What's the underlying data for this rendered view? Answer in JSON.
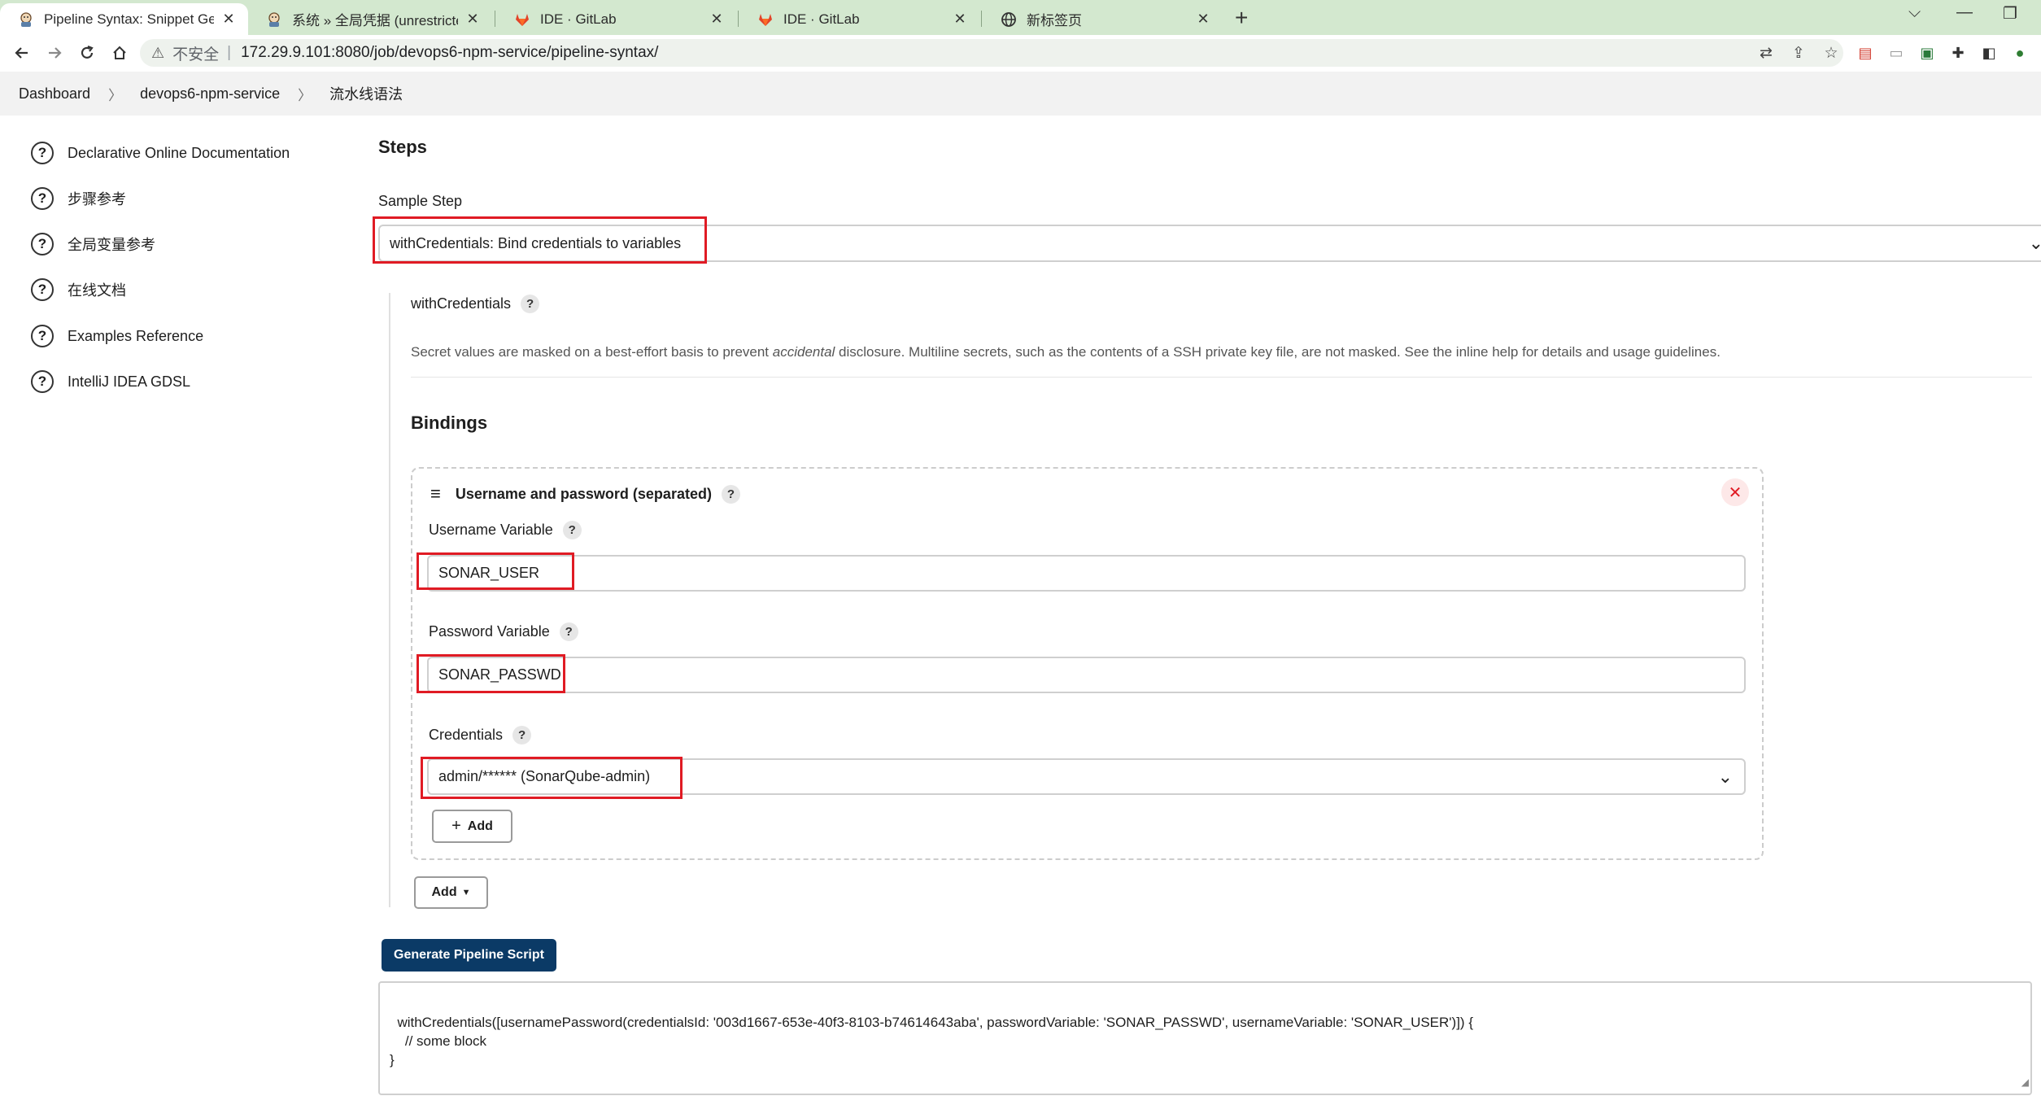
{
  "browser": {
    "tabs": [
      {
        "label": "Pipeline Syntax: Snippet Gene",
        "active": true,
        "icon": "jenkins-icon"
      },
      {
        "label": "系统 » 全局凭据 (unrestricted)",
        "active": false,
        "icon": "jenkins-icon"
      },
      {
        "label": "IDE · GitLab",
        "active": false,
        "icon": "gitlab-icon"
      },
      {
        "label": "IDE · GitLab",
        "active": false,
        "icon": "gitlab-icon"
      },
      {
        "label": "新标签页",
        "active": false,
        "icon": "globe-icon"
      }
    ],
    "address": {
      "security_label": "不安全",
      "url": "172.29.9.101:8080/job/devops6-npm-service/pipeline-syntax/"
    }
  },
  "breadcrumb": {
    "items": [
      "Dashboard",
      "devops6-npm-service",
      "流水线语法"
    ]
  },
  "sidebar": {
    "items": [
      {
        "label": "Declarative Online Documentation"
      },
      {
        "label": "步骤参考"
      },
      {
        "label": "全局变量参考"
      },
      {
        "label": "在线文档"
      },
      {
        "label": "Examples Reference"
      },
      {
        "label": "IntelliJ IDEA GDSL"
      }
    ]
  },
  "main": {
    "steps_heading": "Steps",
    "sample_step_label": "Sample Step",
    "sample_step_value": "withCredentials: Bind credentials to variables",
    "step_name": "withCredentials",
    "desc_before": "Secret values are masked on a best-effort basis to prevent ",
    "desc_em": "accidental",
    "desc_after": " disclosure. Multiline secrets, such as the contents of a SSH private key file, are not masked. See the inline help for details and usage guidelines.",
    "bindings_heading": "Bindings",
    "binding": {
      "title": "Username and password (separated)",
      "username_label": "Username Variable",
      "username_value": "SONAR_USER",
      "password_label": "Password Variable",
      "password_value": "SONAR_PASSWD",
      "credentials_label": "Credentials",
      "credentials_value": "admin/****** (SonarQube-admin)",
      "add_label": "Add"
    },
    "add_binding_label": "Add",
    "generate_label": "Generate Pipeline Script",
    "script": "withCredentials([usernamePassword(credentialsId: '003d1667-653e-40f3-8103-b74614643aba', passwordVariable: 'SONAR_PASSWD', usernameVariable: 'SONAR_USER')]) {\n    // some block\n}"
  },
  "colors": {
    "highlight": "#e01b24",
    "primary_button": "#0b3a66",
    "tabstrip": "#d3e8cf"
  }
}
